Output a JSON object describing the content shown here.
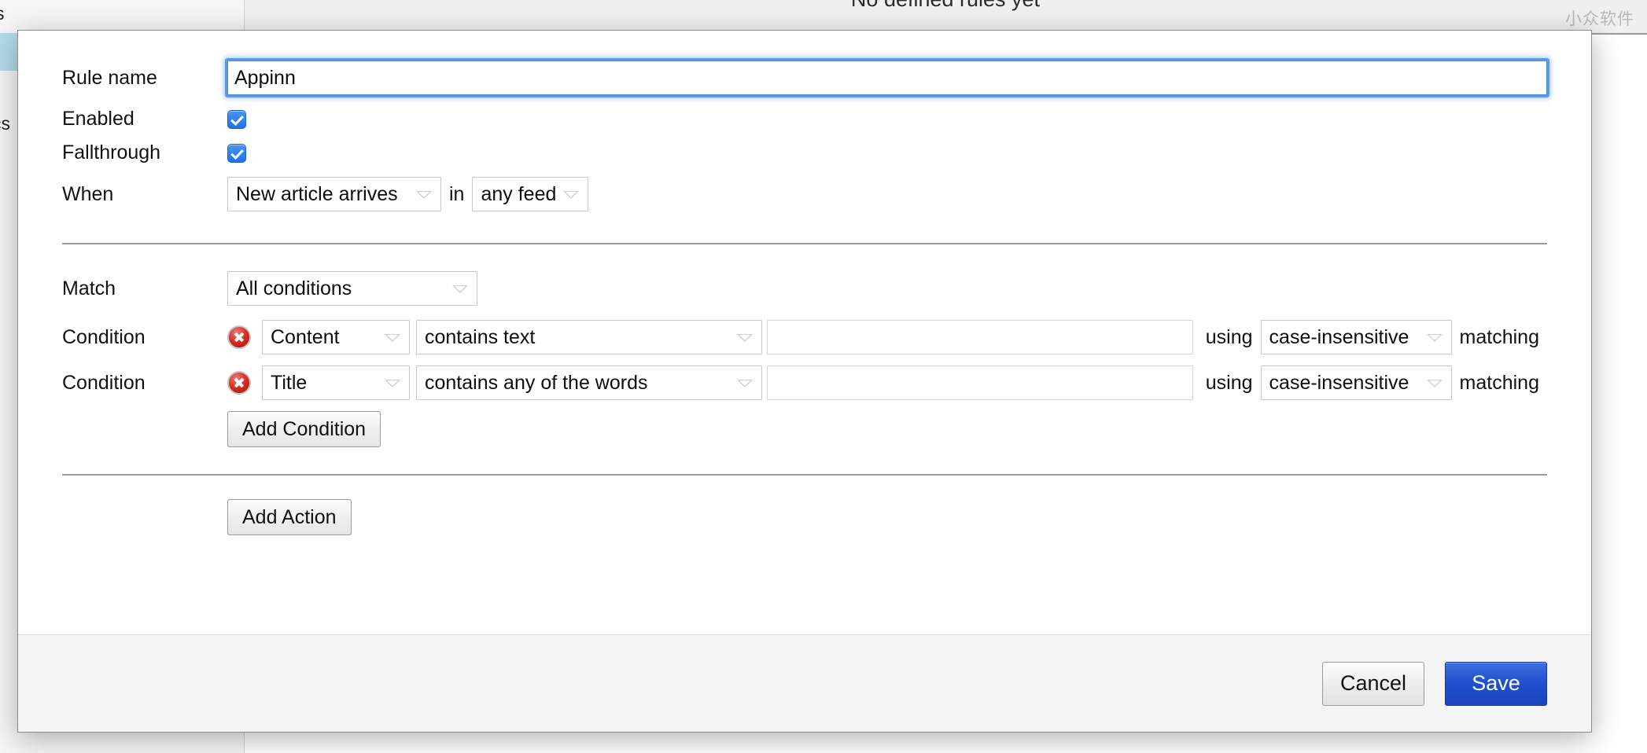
{
  "background": {
    "empty_state_text": "No defined rules yet",
    "watermark": "小众软件",
    "sidebar_label_top": "s",
    "sidebar_label_mid": "cs"
  },
  "dialog": {
    "rule_name": {
      "label": "Rule name",
      "value": "Appinn",
      "placeholder": ""
    },
    "enabled": {
      "label": "Enabled",
      "checked": true
    },
    "fallthrough": {
      "label": "Fallthrough",
      "checked": true
    },
    "when": {
      "label": "When",
      "event": "New article arrives",
      "joiner": "in",
      "scope": "any feed"
    },
    "match": {
      "label": "Match",
      "value": "All conditions"
    },
    "conditions": [
      {
        "label": "Condition",
        "field": "Content",
        "operator": "contains text",
        "value": "",
        "using_word": "using",
        "matching_mode": "case-insensitive",
        "matching_word": "matching"
      },
      {
        "label": "Condition",
        "field": "Title",
        "operator": "contains any of the words",
        "value": "",
        "using_word": "using",
        "matching_mode": "case-insensitive",
        "matching_word": "matching"
      }
    ],
    "add_condition_label": "Add Condition",
    "add_action_label": "Add Action",
    "footer": {
      "cancel_label": "Cancel",
      "save_label": "Save"
    }
  },
  "colors": {
    "accent_blue": "#2050cd",
    "focus_ring": "#4a8fe0",
    "delete_red": "#d42a1f",
    "selected_sidebar": "#b4dcec"
  }
}
